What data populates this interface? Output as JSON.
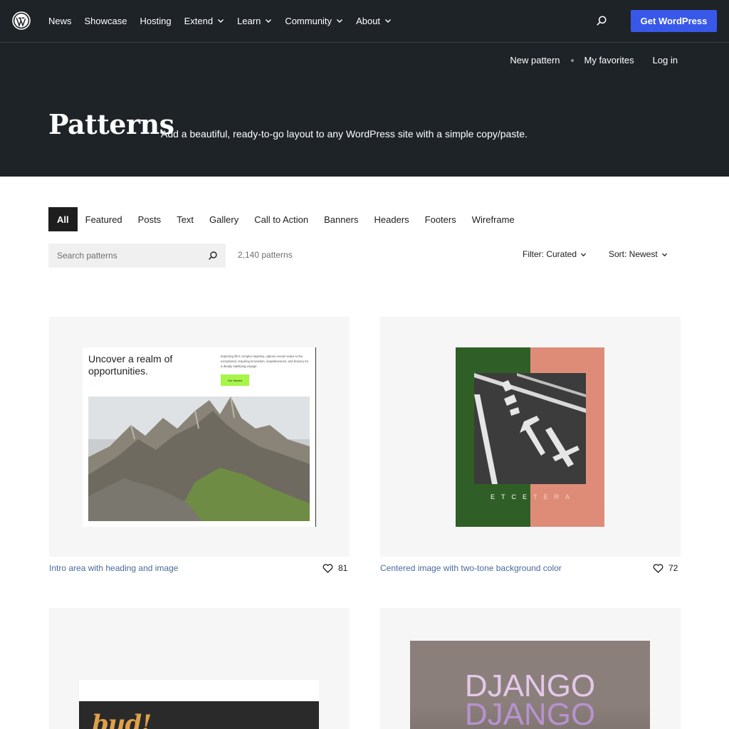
{
  "nav": {
    "items": [
      {
        "label": "News",
        "dropdown": false
      },
      {
        "label": "Showcase",
        "dropdown": false
      },
      {
        "label": "Hosting",
        "dropdown": false
      },
      {
        "label": "Extend",
        "dropdown": true
      },
      {
        "label": "Learn",
        "dropdown": true
      },
      {
        "label": "Community",
        "dropdown": true
      },
      {
        "label": "About",
        "dropdown": true
      }
    ],
    "cta_label": "Get WordPress"
  },
  "subnav": {
    "new_pattern": "New pattern",
    "my_favorites": "My favorites",
    "log_in": "Log in"
  },
  "hero": {
    "title": "Patterns",
    "description": "Add a beautiful, ready-to-go layout to any WordPress site with a simple copy/paste."
  },
  "categories": [
    "All",
    "Featured",
    "Posts",
    "Text",
    "Gallery",
    "Call to Action",
    "Banners",
    "Headers",
    "Footers",
    "Wireframe"
  ],
  "active_category": "All",
  "search": {
    "placeholder": "Search patterns",
    "count": "2,140 patterns"
  },
  "filter_label": "Filter: Curated",
  "sort_label": "Sort: Newest",
  "patterns": [
    {
      "title": "Intro area with heading and image",
      "likes": "81",
      "preview": {
        "heading": "Uncover a realm of opportunities.",
        "body": "Exploring life's complex tapestry, options reveal routes to the exceptional, requiring innovation, inquisitiveness, and bravery for a deeply satisfying voyage.",
        "button": "Get Started"
      }
    },
    {
      "title": "Centered image with two-tone background color",
      "likes": "72",
      "preview": {
        "caption_left": "ETCE",
        "caption_right": "TERA"
      }
    },
    {
      "preview": {
        "text": "bud!"
      }
    },
    {
      "preview": {
        "text": "DJANGO",
        "text_echo": "DJANGO"
      }
    }
  ],
  "colors": {
    "header_bg": "#1e2328",
    "accent": "#3858e9",
    "card_bg": "#f6f6f6",
    "link": "#4a6b9a"
  }
}
